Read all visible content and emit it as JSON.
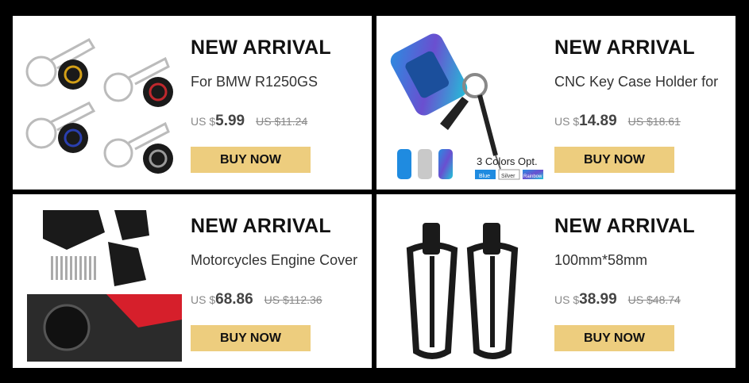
{
  "cards": [
    {
      "badge": "NEW ARRIVAL",
      "title": "For BMW R1250GS",
      "currency": "US $",
      "price": "5.99",
      "old_price": "US $11.24",
      "button": "BUY NOW"
    },
    {
      "badge": "NEW ARRIVAL",
      "title": "CNC Key Case Holder for",
      "currency": "US $",
      "price": "14.89",
      "old_price": "US $18.61",
      "button": "BUY NOW",
      "image_text": {
        "colors": "3 Colors Opt.",
        "blue": "Blue",
        "silver": "Silver",
        "rainbow": "Rainbow"
      }
    },
    {
      "badge": "NEW ARRIVAL",
      "title": "Motorcycles Engine Cover",
      "currency": "US $",
      "price": "68.86",
      "old_price": "US $112.36",
      "button": "BUY NOW"
    },
    {
      "badge": "NEW ARRIVAL",
      "title": "100mm*58mm",
      "currency": "US $",
      "price": "38.99",
      "old_price": "US $48.74",
      "button": "BUY NOW"
    }
  ],
  "colors": {
    "button_bg": "#edcd7e",
    "page_bg": "#000000",
    "card_bg": "#ffffff"
  }
}
